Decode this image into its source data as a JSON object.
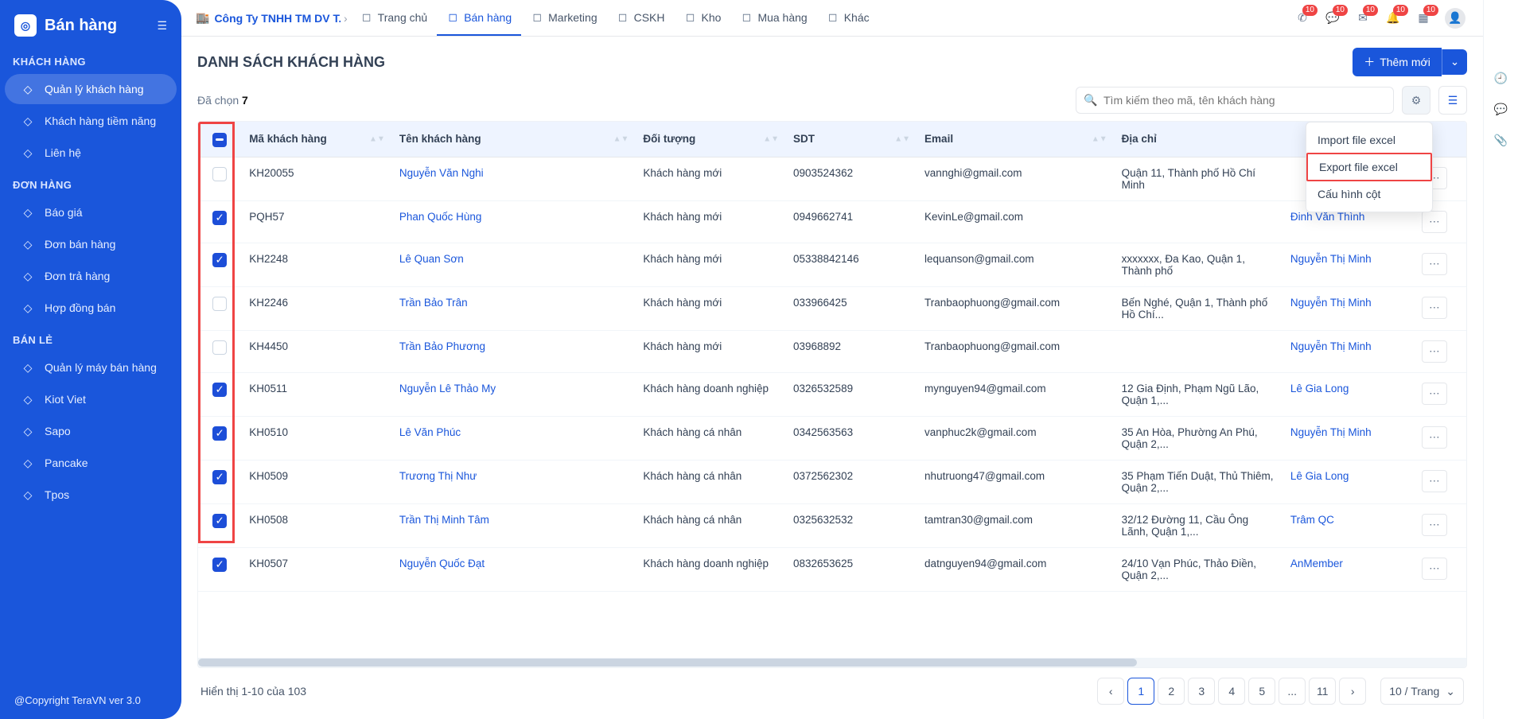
{
  "sidebar": {
    "title": "Bán hàng",
    "groups": [
      {
        "label": "KHÁCH HÀNG",
        "items": [
          {
            "label": "Quản lý khách hàng",
            "active": true
          },
          {
            "label": "Khách hàng tiềm năng"
          },
          {
            "label": "Liên hệ"
          }
        ]
      },
      {
        "label": "ĐƠN HÀNG",
        "items": [
          {
            "label": "Báo giá"
          },
          {
            "label": "Đơn bán hàng"
          },
          {
            "label": "Đơn trả hàng"
          },
          {
            "label": "Hợp đồng bán"
          }
        ]
      },
      {
        "label": "BÁN LẺ",
        "items": [
          {
            "label": "Quản lý máy bán hàng"
          },
          {
            "label": "Kiot Viet"
          },
          {
            "label": "Sapo"
          },
          {
            "label": "Pancake"
          },
          {
            "label": "Tpos"
          }
        ]
      }
    ],
    "footer": "@Copyright TeraVN ver 3.0"
  },
  "topnav": {
    "company": "Công Ty TNHH TM DV T...",
    "tabs": [
      {
        "label": "Trang chủ"
      },
      {
        "label": "Bán hàng",
        "active": true
      },
      {
        "label": "Marketing"
      },
      {
        "label": "CSKH"
      },
      {
        "label": "Kho"
      },
      {
        "label": "Mua hàng"
      },
      {
        "label": "Khác"
      }
    ],
    "badges": {
      "phone": "10",
      "chat": "10",
      "mail": "10",
      "bell": "10",
      "square": "10"
    }
  },
  "page": {
    "title": "DANH SÁCH KHÁCH HÀNG",
    "addBtn": "Thêm mới",
    "selectedLabel": "Đã chọn",
    "selectedCount": "7",
    "searchPlaceholder": "Tìm kiếm theo mã, tên khách hàng",
    "dropdown": {
      "import": "Import file excel",
      "export": "Export file excel",
      "cols": "Cấu hình cột"
    },
    "columns": [
      "Mã khách hàng",
      "Tên khách hàng",
      "Đối tượng",
      "SDT",
      "Email",
      "Địa chỉ",
      ""
    ],
    "rows": [
      {
        "checked": false,
        "code": "KH20055",
        "name": "Nguyễn Văn Nghi",
        "type": "Khách hàng mới",
        "phone": "0903524362",
        "email": "vannghi@gmail.com",
        "addr": "Quận 11, Thành phố Hồ Chí Minh",
        "owner": ""
      },
      {
        "checked": true,
        "code": "PQH57",
        "name": "Phan Quốc Hùng",
        "type": "Khách hàng mới",
        "phone": "0949662741",
        "email": "KevinLe@gmail.com",
        "addr": "",
        "owner": "Đinh Văn Thình"
      },
      {
        "checked": true,
        "code": "KH2248",
        "name": "Lê Quan Sơn",
        "type": "Khách hàng mới",
        "phone": "05338842146",
        "email": "lequanson@gmail.com",
        "addr": "xxxxxxx, Đa Kao, Quận 1, Thành phố",
        "owner": "Nguyễn Thị Minh"
      },
      {
        "checked": false,
        "code": "KH2246",
        "name": "Trần Bảo Trân",
        "type": "Khách hàng mới",
        "phone": "033966425",
        "email": "Tranbaophuong@gmail.com",
        "addr": "Bến Nghé, Quận 1, Thành phố Hồ Chí...",
        "owner": "Nguyễn Thị Minh"
      },
      {
        "checked": false,
        "code": "KH4450",
        "name": "Trần Bảo Phương",
        "type": "Khách hàng mới",
        "phone": "03968892",
        "email": "Tranbaophuong@gmail.com",
        "addr": "",
        "owner": "Nguyễn Thị Minh"
      },
      {
        "checked": true,
        "code": "KH0511",
        "name": "Nguyễn Lê Thảo My",
        "type": "Khách hàng doanh nghiệp",
        "phone": "0326532589",
        "email": "mynguyen94@gmail.com",
        "addr": "12 Gia Định, Phạm Ngũ Lão, Quận 1,...",
        "owner": "Lê Gia Long"
      },
      {
        "checked": true,
        "code": "KH0510",
        "name": "Lê Văn Phúc",
        "type": "Khách hàng cá nhân",
        "phone": "0342563563",
        "email": "vanphuc2k@gmail.com",
        "addr": "35 An Hòa, Phường An Phú, Quận 2,...",
        "owner": "Nguyễn Thị Minh"
      },
      {
        "checked": true,
        "code": "KH0509",
        "name": "Trương Thị Như",
        "type": "Khách hàng cá nhân",
        "phone": "0372562302",
        "email": "nhutruong47@gmail.com",
        "addr": "35 Phạm Tiến Duật, Thủ Thiêm, Quận 2,...",
        "owner": "Lê Gia Long"
      },
      {
        "checked": true,
        "code": "KH0508",
        "name": "Trần Thị Minh Tâm",
        "type": "Khách hàng cá nhân",
        "phone": "0325632532",
        "email": "tamtran30@gmail.com",
        "addr": "32/12 Đường 11, Cầu Ông Lãnh, Quận 1,...",
        "owner": "Trâm QC"
      },
      {
        "checked": true,
        "code": "KH0507",
        "name": "Nguyễn Quốc Đạt",
        "type": "Khách hàng doanh nghiệp",
        "phone": "0832653625",
        "email": "datnguyen94@gmail.com",
        "addr": "24/10 Vạn Phúc, Thảo Điền, Quận 2,...",
        "owner": "AnMember"
      }
    ],
    "footerInfo": "Hiển thị 1-10 của 103",
    "pages": [
      "1",
      "2",
      "3",
      "4",
      "5",
      "...",
      "11"
    ],
    "pageSize": "10 / Trang"
  }
}
